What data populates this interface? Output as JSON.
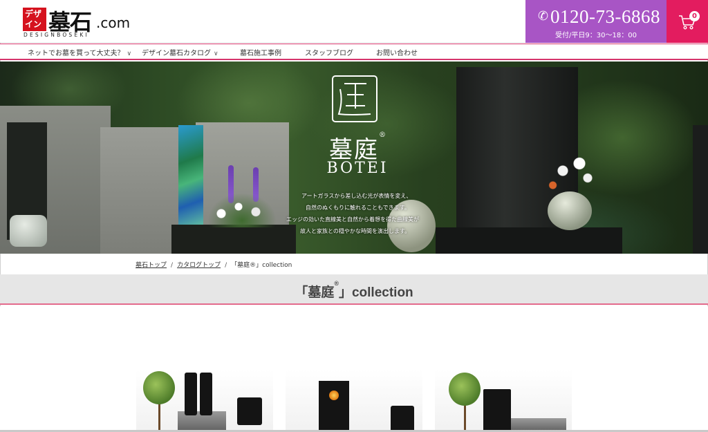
{
  "header": {
    "logo_mark": "デザイン",
    "logo_main": "墓石",
    "logo_com": ".com",
    "logo_sub": "DESIGNBOSEKI",
    "phone_number": "0120-73-6868",
    "phone_hours": "受付/平日9：30〜18：00",
    "cart_count": "0",
    "accent_purple": "#a855c5",
    "accent_pink": "#e31c5f"
  },
  "nav": {
    "items": [
      {
        "label": "ネットでお墓を買って大丈夫？",
        "has_dropdown": true
      },
      {
        "label": "デザイン墓石カタログ",
        "has_dropdown": true
      },
      {
        "label": "墓石施工事例",
        "has_dropdown": false
      },
      {
        "label": "スタッフブログ",
        "has_dropdown": false
      },
      {
        "label": "お問い合わせ",
        "has_dropdown": false
      }
    ],
    "dropdown_glyph": "∨"
  },
  "hero": {
    "brand_jp": "墓庭",
    "brand_registered": "®",
    "brand_en": "BOTEI",
    "lines": [
      "アートガラスから差し込む光が表情を変え、",
      "自然のぬくもりに触れることもできます。",
      "エッジの効いた直線美と自然から着想を得た曲線美が",
      "故人と家族との穏やかな時間を演出します。"
    ]
  },
  "breadcrumb": {
    "items": [
      "墓石トップ",
      "カタログトップ",
      "「墓庭®」collection"
    ],
    "separator": "/"
  },
  "page_title": {
    "open": "「墓庭",
    "registered": "®",
    "close": "」collection"
  },
  "products": [
    {
      "icon": "monument-thumbnail"
    },
    {
      "icon": "monument-thumbnail"
    },
    {
      "icon": "monument-thumbnail"
    }
  ]
}
